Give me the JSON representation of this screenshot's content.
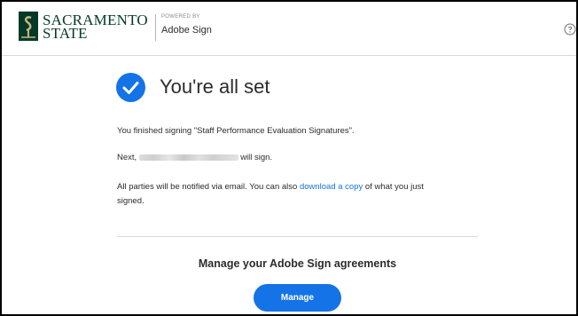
{
  "header": {
    "brand_line1": "SACRAMENTO",
    "brand_line2": "STATE",
    "powered_by": "POWERED BY",
    "product": "Adobe Sign",
    "help_icon": "question-circle-icon"
  },
  "main": {
    "title": "You're all set",
    "finished_text": "You finished signing \"Staff Performance Evaluation Signatures\".",
    "next_prefix": "Next,",
    "next_suffix": "will sign.",
    "notify_text": "All parties will be notified via email. You can also",
    "download_link": "download a copy",
    "notify_suffix": "of what you just",
    "notify_line2": "signed.",
    "manage_heading": "Manage your Adobe Sign agreements",
    "manage_button": "Manage"
  },
  "colors": {
    "accent": "#1473e6",
    "brand_green": "#043927"
  }
}
